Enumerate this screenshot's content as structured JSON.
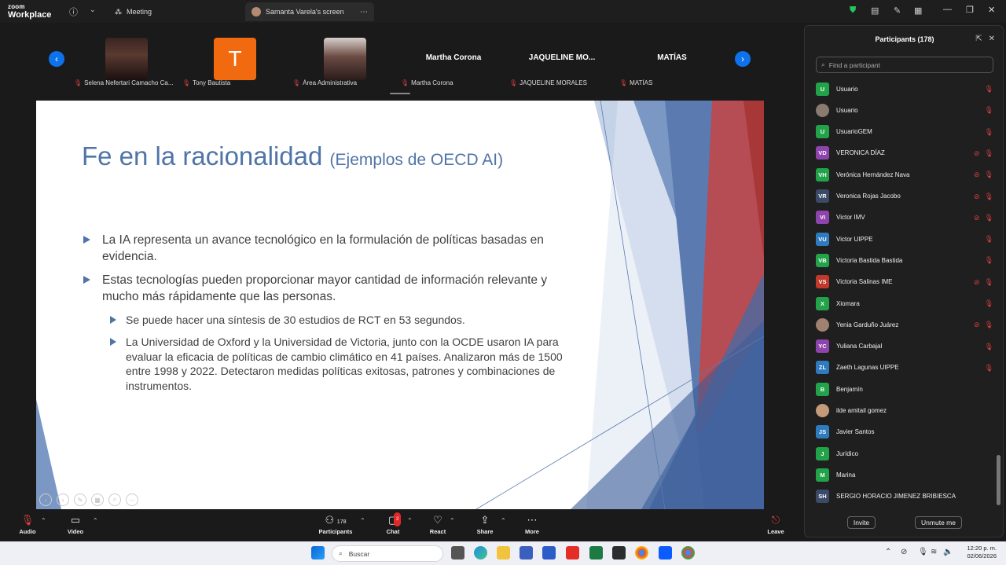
{
  "app": {
    "logo_line1": "zoom",
    "logo_line2": "Workplace",
    "tab_meeting": "Meeting",
    "tab_screen": "Samanta Varela's screen"
  },
  "gallery": {
    "tiles": [
      {
        "name": "Selena Nefertari Camacho Ca...",
        "type": "photo"
      },
      {
        "name": "Tony Bautista",
        "type": "letter",
        "letter": "T"
      },
      {
        "name": "Área Administrativa",
        "type": "photo"
      },
      {
        "name": "Martha Corona",
        "type": "text",
        "big": "Martha Corona"
      },
      {
        "name": "JAQUELINE MORALES",
        "type": "text",
        "big": "JAQUELINE MO..."
      },
      {
        "name": "MATÍAS",
        "type": "text",
        "big": "MATÍAS"
      }
    ]
  },
  "slide": {
    "title": "Fe en la racionalidad",
    "title_sub": "(Ejemplos de OECD AI)",
    "bullet1": "La IA representa un avance tecnológico en la formulación de políticas basadas en evidencia.",
    "bullet2": "Estas tecnologías pueden proporcionar mayor cantidad de información relevante y mucho más rápidamente que las personas.",
    "sub1": "Se puede hacer una síntesis de 30 estudios de RCT en 53 segundos.",
    "sub2": "La Universidad de Oxford y la Universidad de Victoria, junto con la OCDE usaron IA para evaluar la eficacia de políticas de cambio climático en 41 países. Analizaron más de 1500 entre 1998 y 2022. Detectaron medidas políticas exitosas, patrones y combinaciones de instrumentos."
  },
  "panel": {
    "title": "Participants (178)",
    "search_placeholder": "Find a participant",
    "invite": "Invite",
    "unmute": "Unmute me",
    "participants": [
      {
        "initials": "U",
        "name": "Usuario",
        "color": "#22a34a",
        "video_off": false
      },
      {
        "initials": "",
        "name": "Usuario",
        "color": "#8a7a70",
        "video_off": false
      },
      {
        "initials": "U",
        "name": "UsuarioGEM",
        "color": "#22a34a",
        "video_off": false
      },
      {
        "initials": "VD",
        "name": "VERONICA DÍAZ",
        "color": "#8e44ad",
        "video_off": true
      },
      {
        "initials": "VH",
        "name": "Verónica Hernández Nava",
        "color": "#22a34a",
        "video_off": true
      },
      {
        "initials": "VR",
        "name": "Veronica Rojas Jacobo",
        "color": "#3a4a68",
        "video_off": true
      },
      {
        "initials": "VI",
        "name": "Victor IMV",
        "color": "#8e44ad",
        "video_off": true
      },
      {
        "initials": "VU",
        "name": "Victor UIPPE",
        "color": "#2f7bbf",
        "video_off": false
      },
      {
        "initials": "VB",
        "name": "Victoria Bastida Bastida",
        "color": "#22a34a",
        "video_off": false
      },
      {
        "initials": "VS",
        "name": "Victoria Salinas IME",
        "color": "#c0392b",
        "video_off": true
      },
      {
        "initials": "X",
        "name": "Xiomara",
        "color": "#22a34a",
        "video_off": false
      },
      {
        "initials": "",
        "name": "Yenia Garduño Juárez",
        "color": "#a08070",
        "video_off": true
      },
      {
        "initials": "YC",
        "name": "Yuliana Carbajal",
        "color": "#8e44ad",
        "video_off": false
      },
      {
        "initials": "ZL",
        "name": "Zaeth Lagunas UIPPE",
        "color": "#2f7bbf",
        "video_off": false
      },
      {
        "initials": "B",
        "name": "Benjamín",
        "color": "#22a34a",
        "video_off": false
      },
      {
        "initials": "",
        "name": "ilde amitail gomez",
        "color": "#c49a7a",
        "video_off": false
      },
      {
        "initials": "JS",
        "name": "Javier Santos",
        "color": "#2f7bbf",
        "video_off": false
      },
      {
        "initials": "J",
        "name": "Jurídico",
        "color": "#22a34a",
        "video_off": false
      },
      {
        "initials": "M",
        "name": "Marina",
        "color": "#22a34a",
        "video_off": false
      },
      {
        "initials": "SH",
        "name": "SERGIO HORACIO JIMENEZ BRIBIESCA",
        "color": "#3a4a68",
        "video_off": false
      }
    ]
  },
  "controls": {
    "audio": "Audio",
    "video": "Video",
    "participants": "Participants",
    "participants_count": "178",
    "chat": "Chat",
    "chat_badge": "2",
    "react": "React",
    "share": "Share",
    "more": "More",
    "leave": "Leave"
  },
  "taskbar": {
    "search": "Buscar",
    "time": "12:20 p. m.",
    "date": "02/06/2026"
  }
}
